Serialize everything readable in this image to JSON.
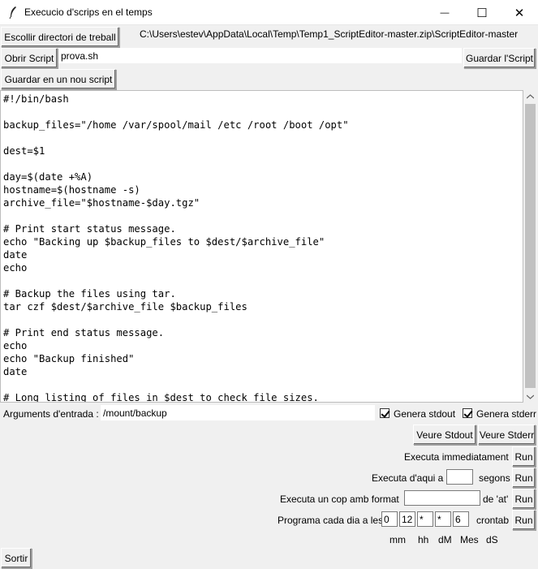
{
  "window": {
    "title": "Execucio d'scrips en el temps",
    "minimize_glyph": "—",
    "maximize_glyph": "☐",
    "close_glyph": "✕"
  },
  "toolbar": {
    "choose_dir_label": "Escollir directori de treball",
    "dir_path": "C:\\Users\\estev\\AppData\\Local\\Temp\\Temp1_ScriptEditor-master.zip\\ScriptEditor-master",
    "open_script_label": "Obrir Script",
    "script_name": "prova.sh",
    "save_script_label": "Guardar l'Script",
    "save_new_label": "Guardar en un nou script"
  },
  "editor": {
    "code": "#!/bin/bash\n\nbackup_files=\"/home /var/spool/mail /etc /root /boot /opt\"\n\ndest=$1\n\nday=$(date +%A)\nhostname=$(hostname -s)\narchive_file=\"$hostname-$day.tgz\"\n\n# Print start status message.\necho \"Backing up $backup_files to $dest/$archive_file\"\ndate\necho\n\n# Backup the files using tar.\ntar czf $dest/$archive_file $backup_files\n\n# Print end status message.\necho\necho \"Backup finished\"\ndate\n\n# Long listing of files in $dest to check file sizes."
  },
  "args": {
    "label": "Arguments d'entrada :",
    "value": "/mount/backup",
    "gen_stdout_label": "Genera stdout",
    "gen_stdout_checked": true,
    "gen_stderr_label": "Genera stderr",
    "gen_stderr_checked": true
  },
  "view": {
    "stdout_label": "Veure Stdout",
    "stderr_label": "Veure Stderr"
  },
  "run": {
    "button_label": "Run",
    "immediate_label": "Executa immediatament",
    "delay_label": "Executa d'aqui a",
    "delay_value": "",
    "delay_unit": "segons",
    "at_label": "Executa un cop amb format",
    "at_value": "",
    "at_suffix": "de 'at'",
    "cron_label": "Programa cada dia a les",
    "cron_fields": [
      "0",
      "12",
      "*",
      "*",
      "6"
    ],
    "cron_suffix": "crontab",
    "cron_headers": [
      "mm",
      "hh",
      "dM",
      "Mes",
      "dS"
    ]
  },
  "footer": {
    "exit_label": "Sortir"
  }
}
